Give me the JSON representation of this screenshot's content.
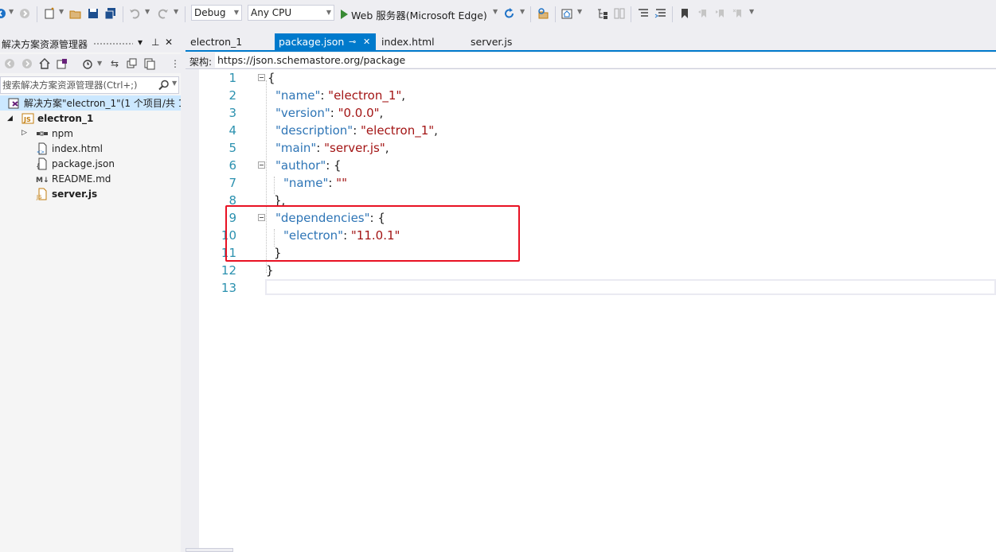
{
  "toolbar": {
    "config_value": "Debug",
    "platform_value": "Any CPU",
    "run_label": "Web 服务器(Microsoft Edge)"
  },
  "solution_explorer": {
    "title": "解决方案资源管理器",
    "search_placeholder": "搜索解决方案资源管理器(Ctrl+;)",
    "solution_label": "解决方案\"electron_1\"(1 个项目/共 1",
    "project_label": "electron_1",
    "items": [
      {
        "label": "npm"
      },
      {
        "label": "index.html"
      },
      {
        "label": "package.json"
      },
      {
        "label": "README.md"
      },
      {
        "label": "server.js"
      }
    ]
  },
  "tabs": [
    {
      "label": "electron_1"
    },
    {
      "label": "package.json"
    },
    {
      "label": "index.html"
    },
    {
      "label": "server.js"
    }
  ],
  "schema": {
    "label": "架构:",
    "value": "https://json.schemastore.org/package"
  },
  "editor": {
    "line_numbers": [
      "1",
      "2",
      "3",
      "4",
      "5",
      "6",
      "7",
      "8",
      "9",
      "10",
      "11",
      "12",
      "13"
    ],
    "lines": [
      {
        "key": "",
        "punct_pre": "{",
        "value": "",
        "punct_post": ""
      },
      {
        "key": "\"name\"",
        "punct_pre": ": ",
        "value": "\"electron_1\"",
        "punct_post": ","
      },
      {
        "key": "\"version\"",
        "punct_pre": ": ",
        "value": "\"0.0.0\"",
        "punct_post": ","
      },
      {
        "key": "\"description\"",
        "punct_pre": ": ",
        "value": "\"electron_1\"",
        "punct_post": ","
      },
      {
        "key": "\"main\"",
        "punct_pre": ": ",
        "value": "\"server.js\"",
        "punct_post": ","
      },
      {
        "key": "\"author\"",
        "punct_pre": ": {",
        "value": "",
        "punct_post": ""
      },
      {
        "key": "\"name\"",
        "punct_pre": ": ",
        "value": "\"\"",
        "punct_post": ""
      },
      {
        "key": "",
        "punct_pre": "},",
        "value": "",
        "punct_post": ""
      },
      {
        "key": "\"dependencies\"",
        "punct_pre": ": {",
        "value": "",
        "punct_post": ""
      },
      {
        "key": "\"electron\"",
        "punct_pre": ": ",
        "value": "\"11.0.1\"",
        "punct_post": ""
      },
      {
        "key": "",
        "punct_pre": "}",
        "value": "",
        "punct_post": ""
      },
      {
        "key": "",
        "punct_pre": "}",
        "value": "",
        "punct_post": ""
      },
      {
        "key": "",
        "punct_pre": "",
        "value": "",
        "punct_post": ""
      }
    ]
  },
  "colors": {
    "accent": "#007acc",
    "json_key": "#2e75b6",
    "json_string": "#a31515",
    "line_number": "#2b91af",
    "highlight_box": "#e81123"
  }
}
